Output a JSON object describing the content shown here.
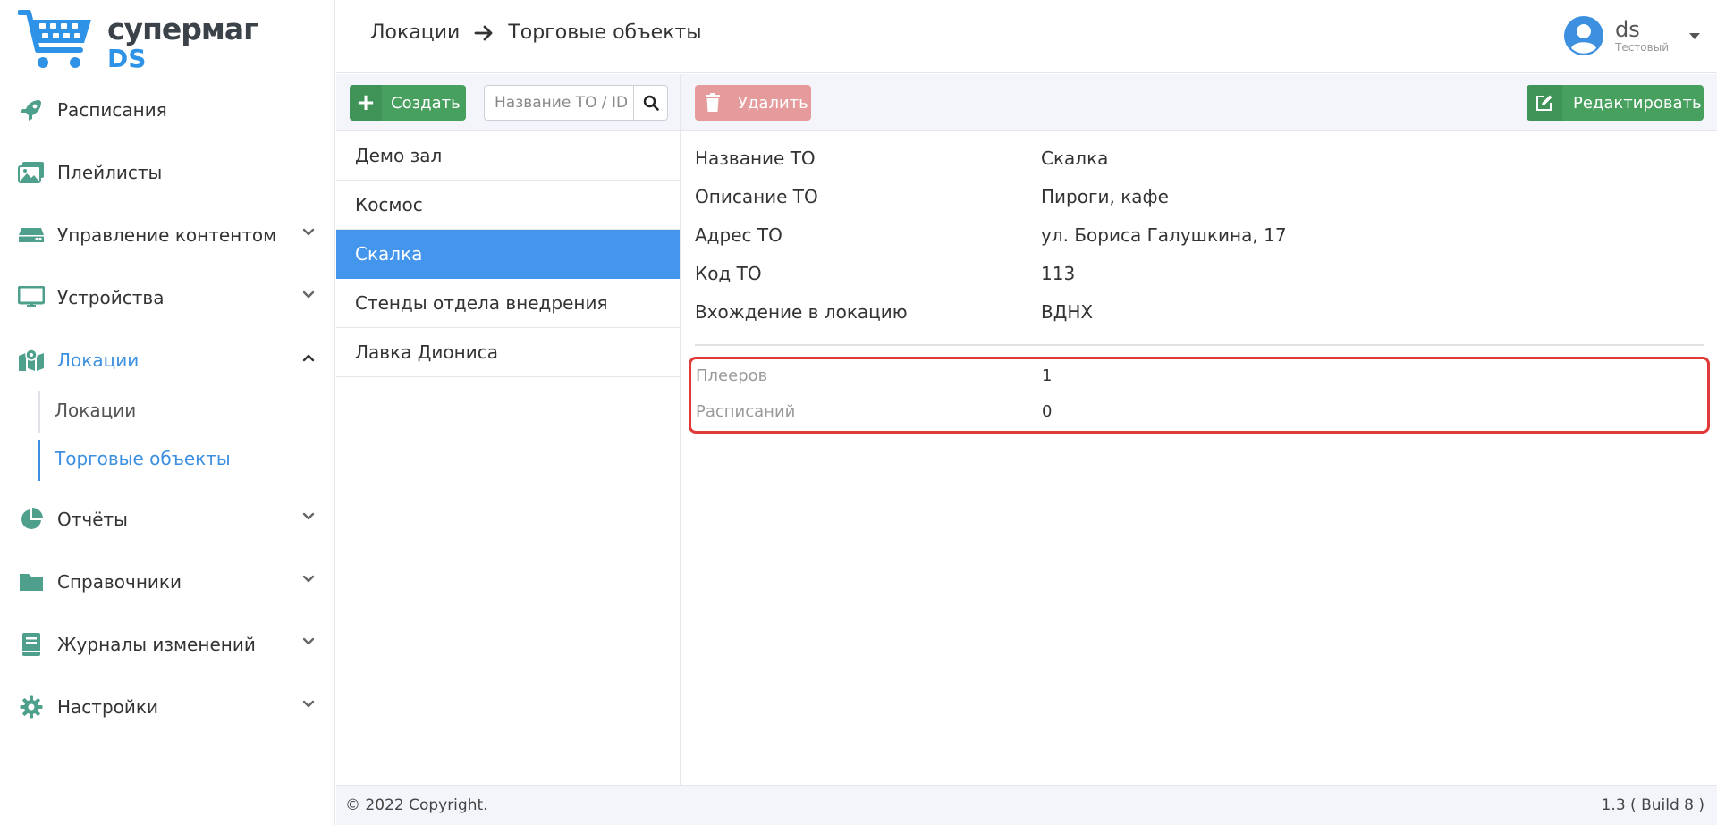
{
  "brand": {
    "line1": "супермаг",
    "line2": "DS"
  },
  "sidebar": {
    "items": [
      {
        "label": "Расписания"
      },
      {
        "label": "Плейлисты"
      },
      {
        "label": "Управление контентом"
      },
      {
        "label": "Устройства"
      },
      {
        "label": "Локации"
      },
      {
        "label": "Отчёты"
      },
      {
        "label": "Справочники"
      },
      {
        "label": "Журналы изменений"
      },
      {
        "label": "Настройки"
      }
    ],
    "submenu": [
      {
        "label": "Локации"
      },
      {
        "label": "Торговые объекты"
      }
    ]
  },
  "header": {
    "breadcrumb": [
      "Локации",
      "Торговые объекты"
    ],
    "user": {
      "name": "ds",
      "role": "Тестовый"
    }
  },
  "list": {
    "create_label": "Создать",
    "search_placeholder": "Название ТО / ID",
    "items": [
      {
        "label": "Демо зал"
      },
      {
        "label": "Космос"
      },
      {
        "label": "Скалка"
      },
      {
        "label": "Стенды отдела внедрения"
      },
      {
        "label": "Лавка Диониса"
      }
    ]
  },
  "detail": {
    "delete_label": "Удалить",
    "edit_label": "Редактировать",
    "props": [
      {
        "key": "Название ТО",
        "value": "Скалка"
      },
      {
        "key": "Описание ТО",
        "value": "Пироги, кафе"
      },
      {
        "key": "Адрес ТО",
        "value": "ул. Бориса Галушкина, 17"
      },
      {
        "key": "Код ТО",
        "value": "113"
      },
      {
        "key": "Вхождение в локацию",
        "value": "ВДНХ"
      }
    ],
    "stats": [
      {
        "key": "Плееров",
        "value": "1"
      },
      {
        "key": "Расписаний",
        "value": "0"
      }
    ]
  },
  "footer": {
    "copyright": "© 2022 Copyright.",
    "version": "1.3 ( Build 8 )"
  },
  "colors": {
    "accent": "#3d8fe0",
    "selected_row": "#4496ec",
    "create_green": "#48a05f",
    "delete_red": "#e59b9b",
    "highlight_border": "#e03a3a",
    "icon_teal": "#4ea08c"
  },
  "icons": [
    "cart-logo-icon",
    "rocket-icon",
    "images-icon",
    "server-icon",
    "monitor-icon",
    "map-icon",
    "pie-chart-icon",
    "folder-icon",
    "book-icon",
    "gear-icon",
    "chevron-down-icon",
    "chevron-up-icon",
    "arrow-right-icon",
    "user-avatar-icon",
    "caret-down-icon",
    "plus-icon",
    "search-icon",
    "trash-icon",
    "edit-icon"
  ]
}
